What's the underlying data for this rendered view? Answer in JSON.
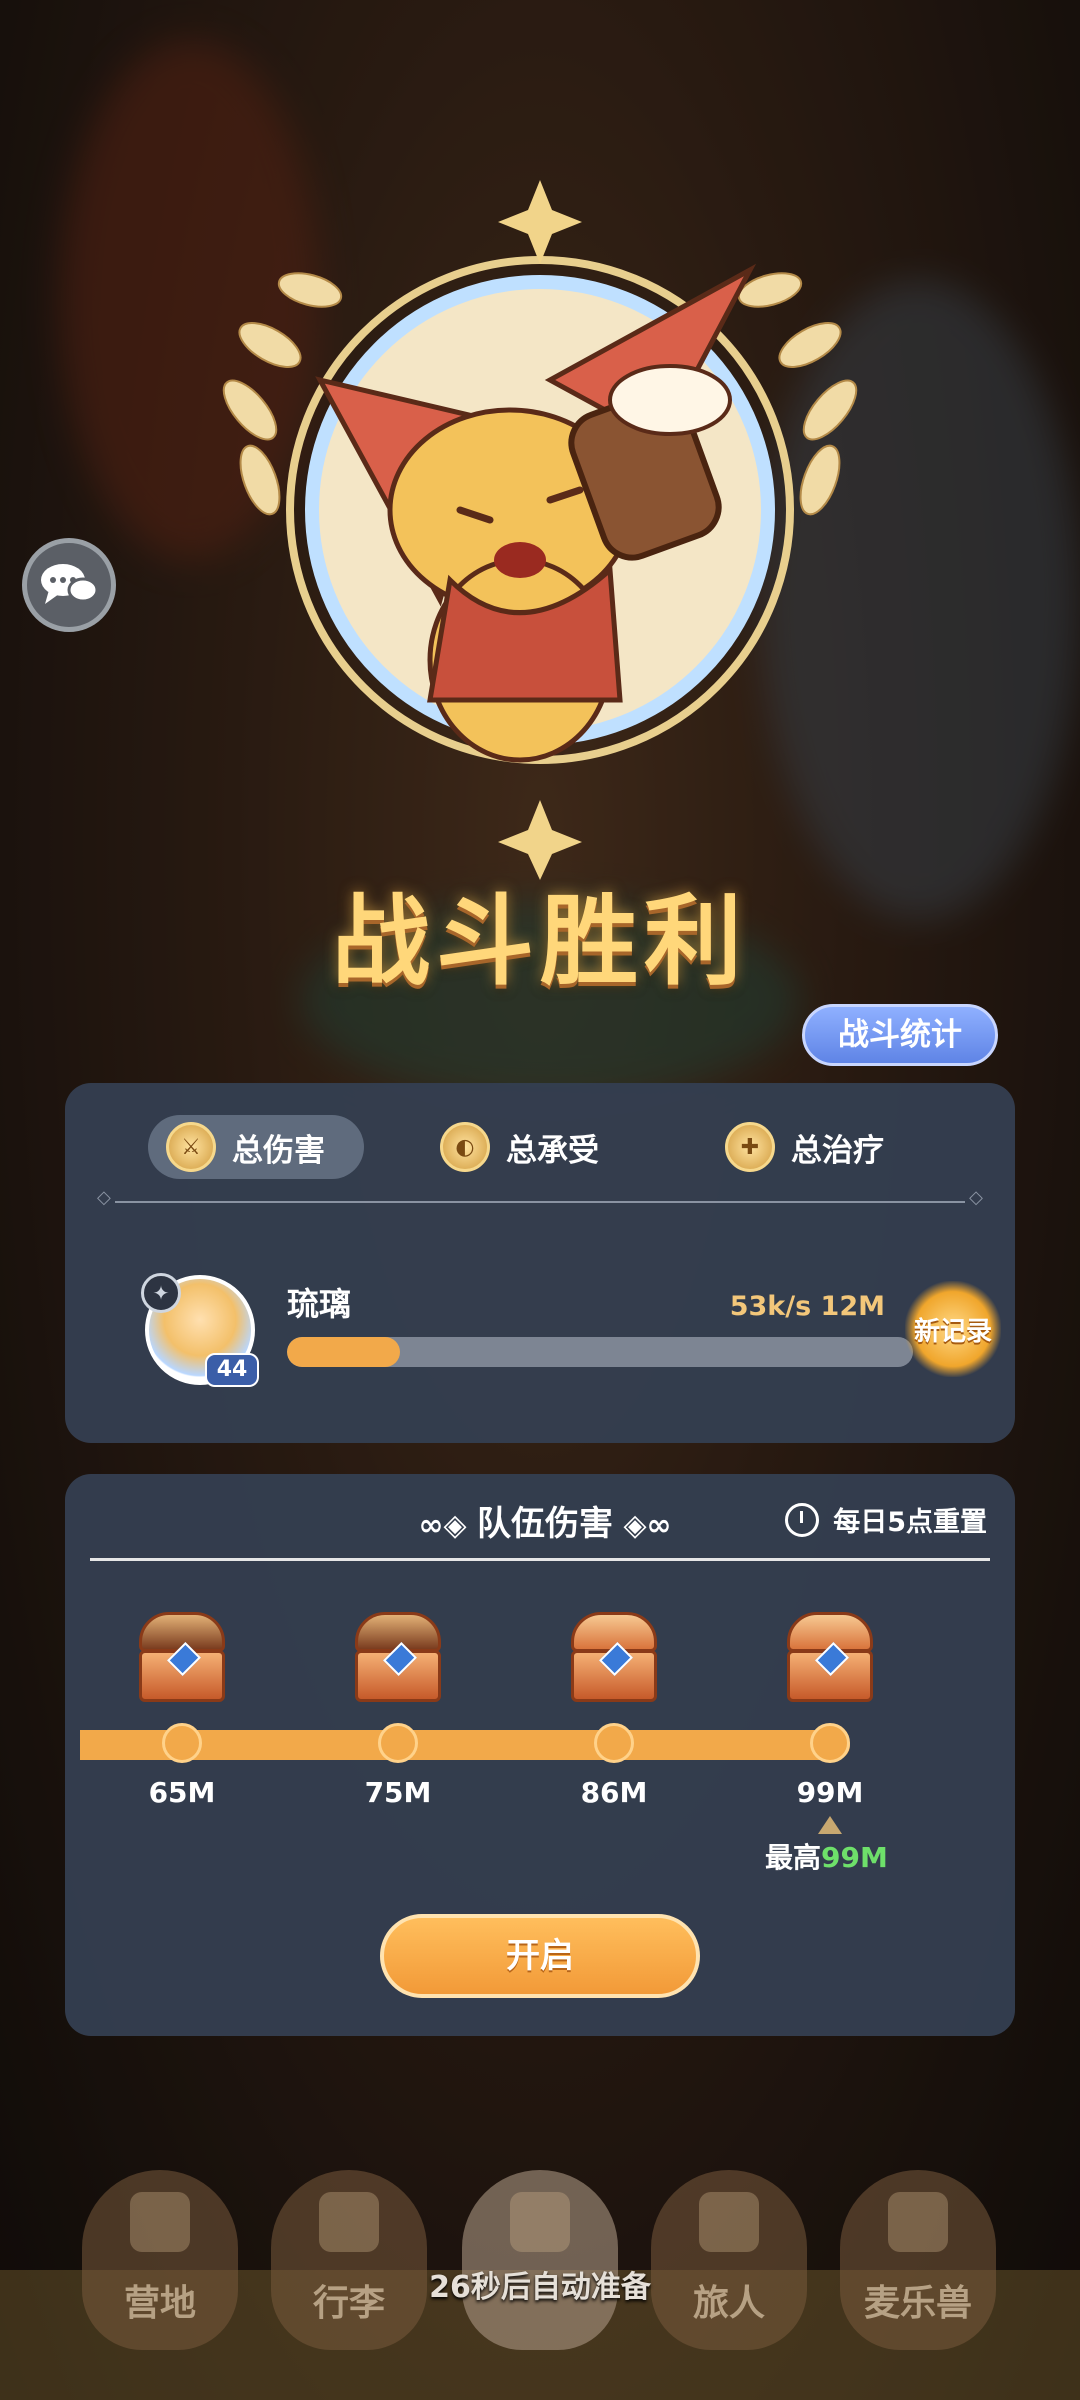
{
  "result_title": "战斗胜利",
  "stats_button_label": "战斗统计",
  "tabs": [
    {
      "label": "总伤害",
      "icon": "sword-icon",
      "active": true
    },
    {
      "label": "总承受",
      "icon": "shield-icon",
      "active": false
    },
    {
      "label": "总治疗",
      "icon": "heal-icon",
      "active": false
    }
  ],
  "hero": {
    "name": "琉璃",
    "level": "44",
    "stat": "53k/s 12M",
    "damage_bar_fraction": 0.18,
    "new_record_label": "新记录"
  },
  "team_damage": {
    "title": "队伍伤害",
    "reset_note": "每日5点重置",
    "milestones": [
      {
        "label": "65M",
        "chest_state": "opened"
      },
      {
        "label": "75M",
        "chest_state": "opened"
      },
      {
        "label": "86M",
        "chest_state": "closed"
      },
      {
        "label": "99M",
        "chest_state": "closed"
      }
    ],
    "best_prefix": "最高",
    "best_value": "99M",
    "open_button_label": "开启"
  },
  "bottom_nav": [
    {
      "label": "营地",
      "icon": "castle-icon"
    },
    {
      "label": "行李",
      "icon": "backpack-icon"
    },
    {
      "label": "",
      "icon": "crossed-swords-icon"
    },
    {
      "label": "旅人",
      "icon": "traveler-icon"
    },
    {
      "label": "麦乐兽",
      "icon": "pet-icon"
    }
  ],
  "auto_ready_text": "26秒后自动准备",
  "colors": {
    "accent_orange": "#f2a94a",
    "panel": "#343e50",
    "best_green": "#6ee06a",
    "title_gold": "#ffd77a"
  }
}
